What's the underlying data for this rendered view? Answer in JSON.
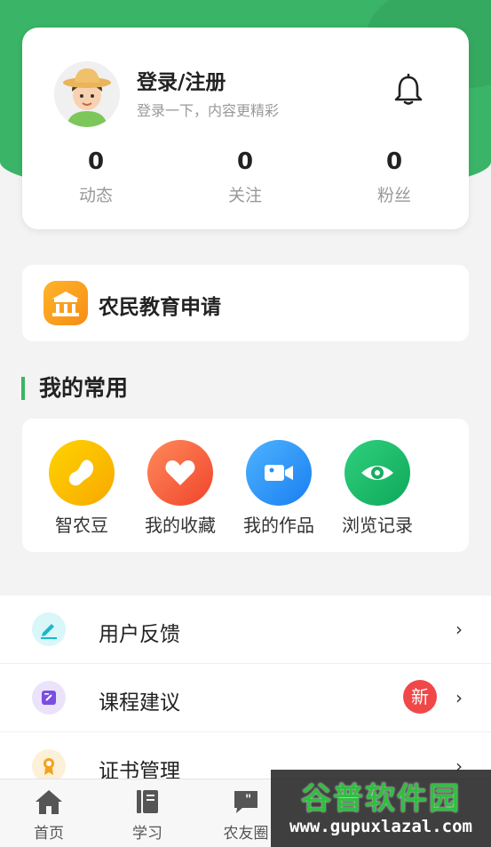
{
  "profile": {
    "login_title": "登录/注册",
    "login_subtitle": "登录一下，内容更精彩",
    "stats": [
      {
        "value": "0",
        "label": "动态"
      },
      {
        "value": "0",
        "label": "关注"
      },
      {
        "value": "0",
        "label": "粉丝"
      }
    ]
  },
  "education": {
    "label": "农民教育申请"
  },
  "favorites": {
    "title": "我的常用",
    "items": [
      {
        "label": "智农豆",
        "icon": "bean-icon"
      },
      {
        "label": "我的收藏",
        "icon": "heart-icon"
      },
      {
        "label": "我的作品",
        "icon": "video-camera-icon"
      },
      {
        "label": "浏览记录",
        "icon": "eye-icon"
      }
    ]
  },
  "menu": {
    "items": [
      {
        "label": "用户反馈",
        "icon": "edit-pen-icon"
      },
      {
        "label": "课程建议",
        "icon": "note-edit-icon",
        "badge": "新"
      },
      {
        "label": "证书管理",
        "icon": "certificate-icon"
      }
    ],
    "chevron": "›"
  },
  "tabbar": {
    "items": [
      {
        "label": "首页",
        "icon": "home-icon"
      },
      {
        "label": "学习",
        "icon": "book-icon"
      },
      {
        "label": "农友圈",
        "icon": "chat-quote-icon"
      }
    ]
  },
  "watermark": {
    "title": "谷普软件园",
    "url": "www.gupuxlazal.com"
  },
  "colors": {
    "accent": "#3ab466",
    "badge": "#f04848",
    "edu": "#f68d14"
  }
}
